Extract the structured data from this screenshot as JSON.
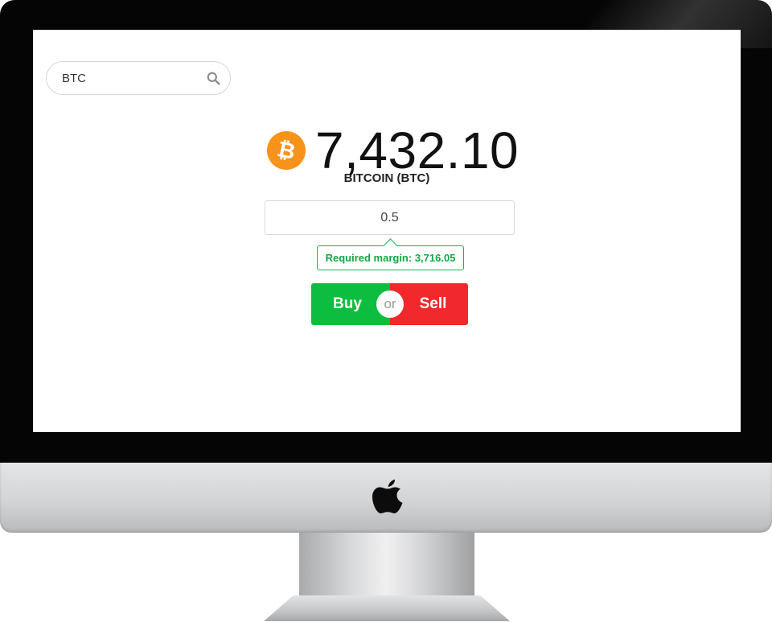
{
  "search": {
    "value": "BTC",
    "icon": "search-icon"
  },
  "asset": {
    "icon": "bitcoin-icon",
    "price": "7,432.10",
    "name": "BITCOIN (BTC)",
    "coin_color": "#f7931a"
  },
  "order": {
    "amount": "0.5",
    "required_margin": "Required margin: 3,716.05"
  },
  "actions": {
    "buy_label": "Buy",
    "or_label": "or",
    "sell_label": "Sell",
    "buy_color": "#0dbd3f",
    "sell_color": "#f2292c"
  },
  "device": {
    "logo": "apple-logo"
  }
}
